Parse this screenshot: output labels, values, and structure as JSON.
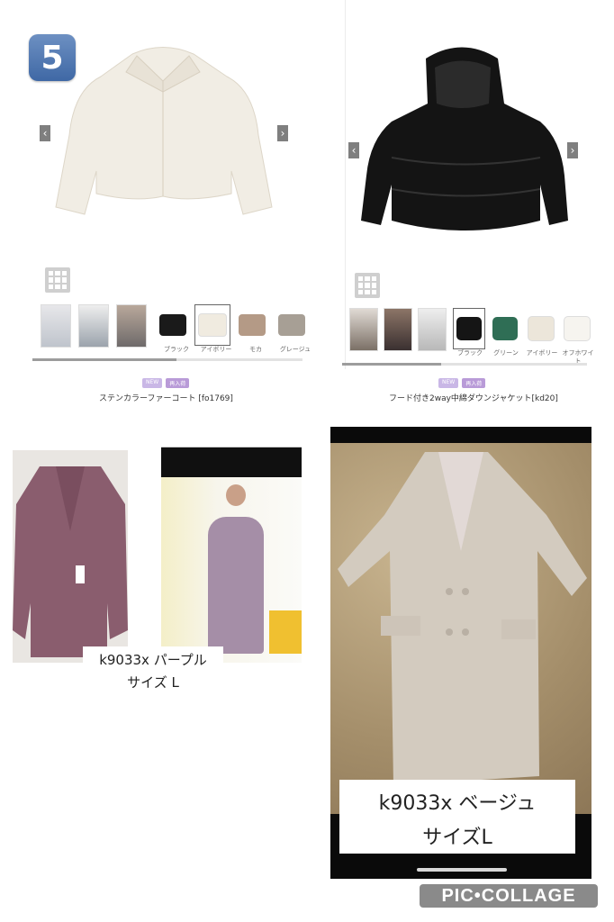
{
  "badge": "5",
  "product1": {
    "tags": [
      "NEW",
      "再入荷"
    ],
    "title": "ステンカラーファーコート [fo1769]",
    "colors": [
      "ブラック",
      "アイボリー",
      "モカ",
      "グレージュ"
    ]
  },
  "product2": {
    "tags": [
      "NEW",
      "再入荷"
    ],
    "title": "フード付き2way中綿ダウンジャケット[kd20]",
    "colors": [
      "ブラック",
      "グリーン",
      "アイボリー",
      "オフホワイト"
    ]
  },
  "caption_left": {
    "line1": "k9033x パープル",
    "line2": "サイズ L"
  },
  "caption_right": {
    "line1": "k9033x ベージュ",
    "line2": "サイズL"
  },
  "watermark": "PIC•COLLAGE",
  "colors": {
    "badge": "#4d74ae",
    "tag_new": "#c9b7e6",
    "tag_restock": "#b99bd8",
    "purple_coat": "#8a5d6e",
    "beige_coat": "#d3cbbf"
  }
}
